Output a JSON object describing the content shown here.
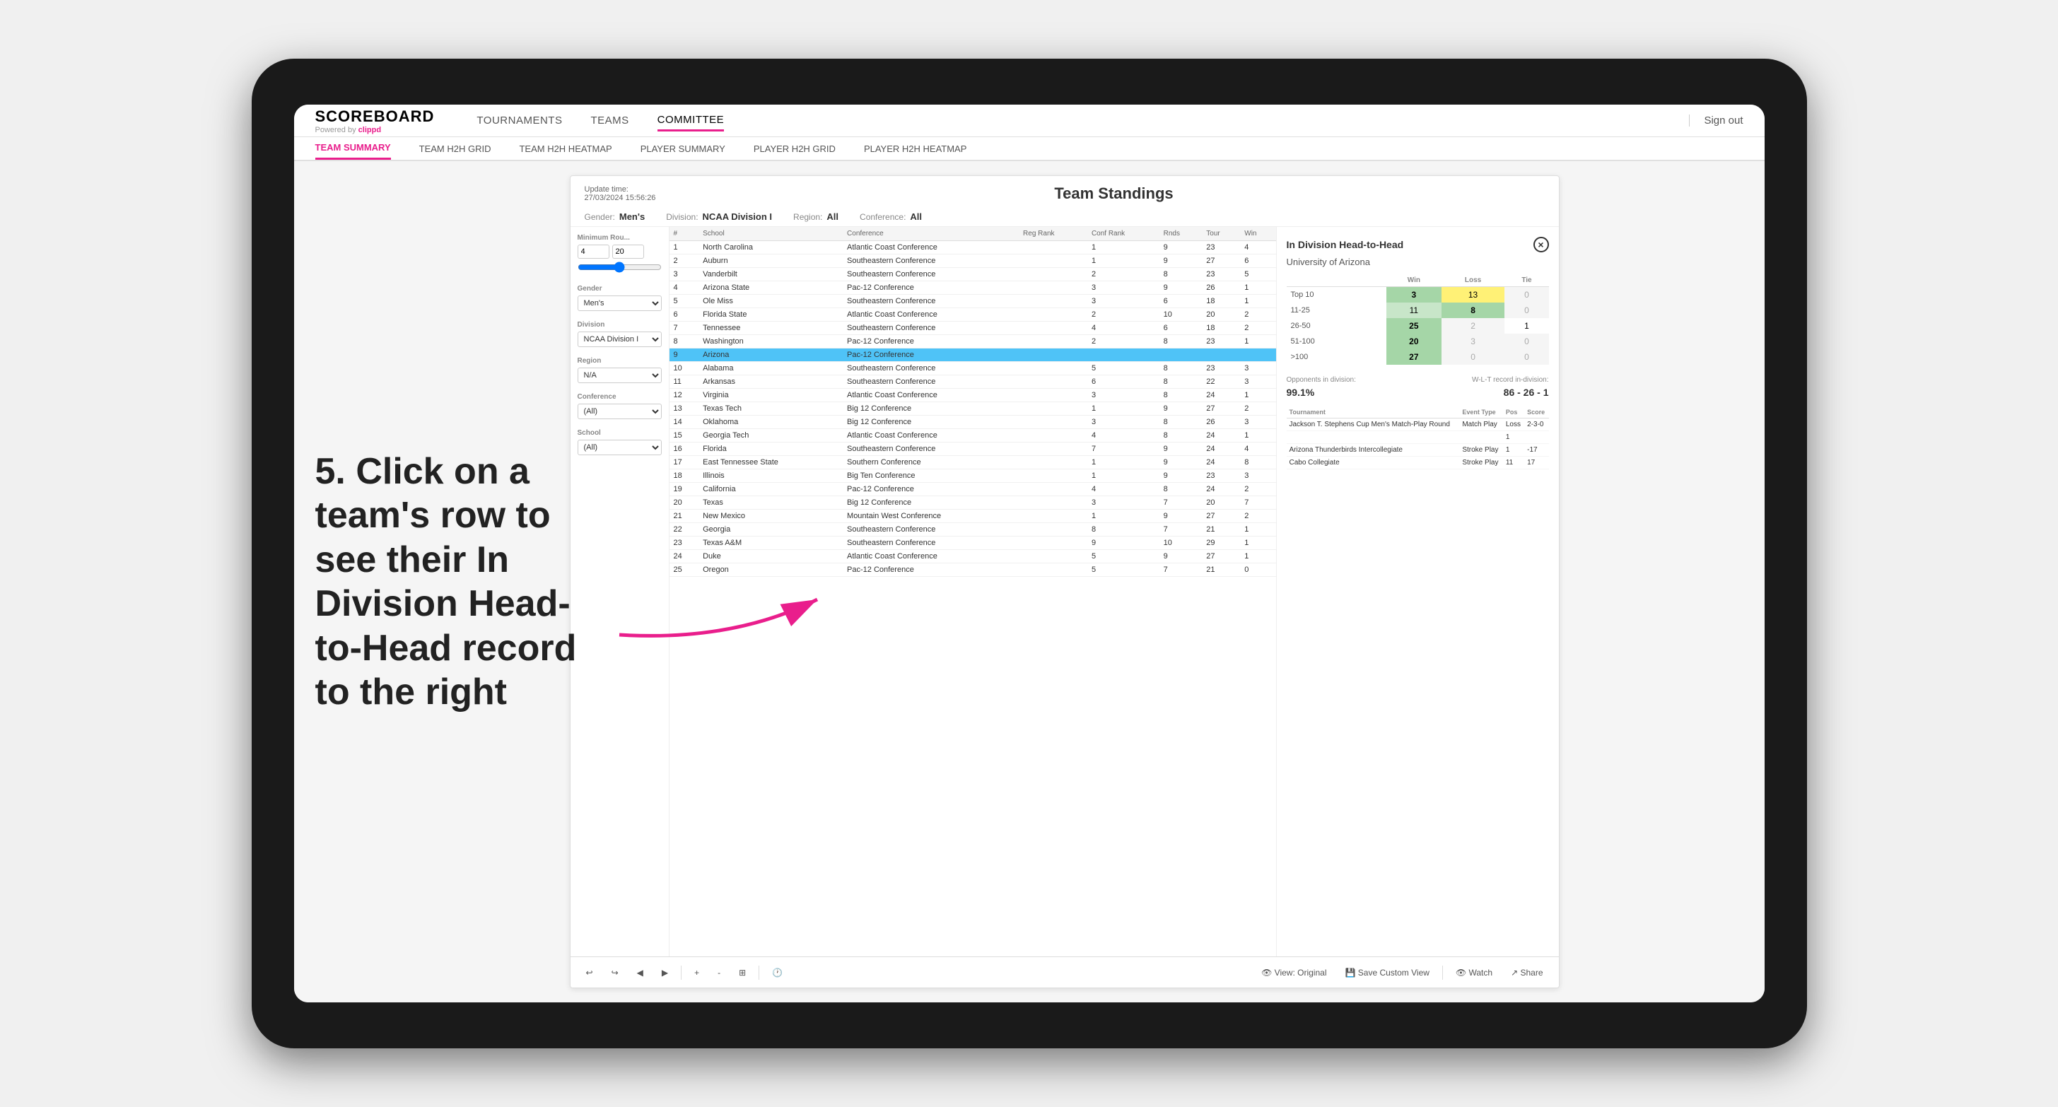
{
  "tablet": {
    "nav": {
      "logo": "SCOREBOARD",
      "powered_by": "Powered by clippd",
      "items": [
        "TOURNAMENTS",
        "TEAMS",
        "COMMITTEE"
      ],
      "active_item": "COMMITTEE",
      "sign_out": "Sign out"
    },
    "sub_nav": {
      "items": [
        "TEAM SUMMARY",
        "TEAM H2H GRID",
        "TEAM H2H HEATMAP",
        "PLAYER SUMMARY",
        "PLAYER H2H GRID",
        "PLAYER H2H HEATMAP"
      ],
      "active_item": "TEAM SUMMARY"
    }
  },
  "annotation": {
    "text": "5. Click on a team's row to see their In Division Head-to-Head record to the right"
  },
  "dashboard": {
    "update_time_label": "Update time:",
    "update_time": "27/03/2024 15:56:26",
    "title": "Team Standings",
    "filters": {
      "gender_label": "Gender:",
      "gender_value": "Men's",
      "division_label": "Division:",
      "division_value": "NCAA Division I",
      "region_label": "Region:",
      "region_value": "All",
      "conference_label": "Conference:",
      "conference_value": "All"
    },
    "sidebar": {
      "min_rounds_label": "Minimum Rou...",
      "min_rounds_from": "4",
      "min_rounds_to": "20",
      "gender_label": "Gender",
      "gender_value": "Men's",
      "division_label": "Division",
      "division_value": "NCAA Division I",
      "region_label": "Region",
      "region_value": "N/A",
      "conference_label": "Conference",
      "conference_value": "(All)",
      "school_label": "School",
      "school_value": "(All)"
    },
    "table": {
      "headers": [
        "#",
        "School",
        "Conference",
        "Reg Rank",
        "Conf Rank",
        "Rnds",
        "Tour",
        "Win"
      ],
      "rows": [
        {
          "rank": 1,
          "school": "North Carolina",
          "conference": "Atlantic Coast Conference",
          "reg_rank": "",
          "conf_rank": 1,
          "rnds": 9,
          "tour": 23,
          "win": 4
        },
        {
          "rank": 2,
          "school": "Auburn",
          "conference": "Southeastern Conference",
          "reg_rank": "",
          "conf_rank": 1,
          "rnds": 9,
          "tour": 27,
          "win": 6
        },
        {
          "rank": 3,
          "school": "Vanderbilt",
          "conference": "Southeastern Conference",
          "reg_rank": "",
          "conf_rank": 2,
          "rnds": 8,
          "tour": 23,
          "win": 5
        },
        {
          "rank": 4,
          "school": "Arizona State",
          "conference": "Pac-12 Conference",
          "reg_rank": "",
          "conf_rank": 3,
          "rnds": 9,
          "tour": 26,
          "win": 1
        },
        {
          "rank": 5,
          "school": "Ole Miss",
          "conference": "Southeastern Conference",
          "reg_rank": "",
          "conf_rank": 3,
          "rnds": 6,
          "tour": 18,
          "win": 1
        },
        {
          "rank": 6,
          "school": "Florida State",
          "conference": "Atlantic Coast Conference",
          "reg_rank": "",
          "conf_rank": 2,
          "rnds": 10,
          "tour": 20,
          "win": 2
        },
        {
          "rank": 7,
          "school": "Tennessee",
          "conference": "Southeastern Conference",
          "reg_rank": "",
          "conf_rank": 4,
          "rnds": 6,
          "tour": 18,
          "win": 2
        },
        {
          "rank": 8,
          "school": "Washington",
          "conference": "Pac-12 Conference",
          "reg_rank": "",
          "conf_rank": 2,
          "rnds": 8,
          "tour": 23,
          "win": 1
        },
        {
          "rank": 9,
          "school": "Arizona",
          "conference": "Pac-12 Conference",
          "reg_rank": "",
          "conf_rank": "",
          "rnds": "",
          "tour": "",
          "win": "",
          "selected": true
        },
        {
          "rank": 10,
          "school": "Alabama",
          "conference": "Southeastern Conference",
          "reg_rank": "",
          "conf_rank": 5,
          "rnds": 8,
          "tour": 23,
          "win": 3
        },
        {
          "rank": 11,
          "school": "Arkansas",
          "conference": "Southeastern Conference",
          "reg_rank": "",
          "conf_rank": 6,
          "rnds": 8,
          "tour": 22,
          "win": 3
        },
        {
          "rank": 12,
          "school": "Virginia",
          "conference": "Atlantic Coast Conference",
          "reg_rank": "",
          "conf_rank": 3,
          "rnds": 8,
          "tour": 24,
          "win": 1
        },
        {
          "rank": 13,
          "school": "Texas Tech",
          "conference": "Big 12 Conference",
          "reg_rank": "",
          "conf_rank": 1,
          "rnds": 9,
          "tour": 27,
          "win": 2
        },
        {
          "rank": 14,
          "school": "Oklahoma",
          "conference": "Big 12 Conference",
          "reg_rank": "",
          "conf_rank": 3,
          "rnds": 8,
          "tour": 26,
          "win": 3
        },
        {
          "rank": 15,
          "school": "Georgia Tech",
          "conference": "Atlantic Coast Conference",
          "reg_rank": "",
          "conf_rank": 4,
          "rnds": 8,
          "tour": 24,
          "win": 1
        },
        {
          "rank": 16,
          "school": "Florida",
          "conference": "Southeastern Conference",
          "reg_rank": "",
          "conf_rank": 7,
          "rnds": 9,
          "tour": 24,
          "win": 4
        },
        {
          "rank": 17,
          "school": "East Tennessee State",
          "conference": "Southern Conference",
          "reg_rank": "",
          "conf_rank": 1,
          "rnds": 9,
          "tour": 24,
          "win": 8
        },
        {
          "rank": 18,
          "school": "Illinois",
          "conference": "Big Ten Conference",
          "reg_rank": "",
          "conf_rank": 1,
          "rnds": 9,
          "tour": 23,
          "win": 3
        },
        {
          "rank": 19,
          "school": "California",
          "conference": "Pac-12 Conference",
          "reg_rank": "",
          "conf_rank": 4,
          "rnds": 8,
          "tour": 24,
          "win": 2
        },
        {
          "rank": 20,
          "school": "Texas",
          "conference": "Big 12 Conference",
          "reg_rank": "",
          "conf_rank": 3,
          "rnds": 7,
          "tour": 20,
          "win": 7
        },
        {
          "rank": 21,
          "school": "New Mexico",
          "conference": "Mountain West Conference",
          "reg_rank": "",
          "conf_rank": 1,
          "rnds": 9,
          "tour": 27,
          "win": 2
        },
        {
          "rank": 22,
          "school": "Georgia",
          "conference": "Southeastern Conference",
          "reg_rank": "",
          "conf_rank": 8,
          "rnds": 7,
          "tour": 21,
          "win": 1
        },
        {
          "rank": 23,
          "school": "Texas A&M",
          "conference": "Southeastern Conference",
          "reg_rank": "",
          "conf_rank": 9,
          "rnds": 10,
          "tour": 29,
          "win": 1
        },
        {
          "rank": 24,
          "school": "Duke",
          "conference": "Atlantic Coast Conference",
          "reg_rank": "",
          "conf_rank": 5,
          "rnds": 9,
          "tour": 27,
          "win": 1
        },
        {
          "rank": 25,
          "school": "Oregon",
          "conference": "Pac-12 Conference",
          "reg_rank": "",
          "conf_rank": 5,
          "rnds": 7,
          "tour": 21,
          "win": 0
        }
      ]
    },
    "h2h_panel": {
      "title": "In Division Head-to-Head",
      "team": "University of Arizona",
      "close_btn": "×",
      "table_headers": [
        "",
        "Win",
        "Loss",
        "Tie"
      ],
      "rows": [
        {
          "label": "Top 10",
          "win": 3,
          "loss": 13,
          "tie": 0,
          "win_color": "green",
          "loss_color": "yellow"
        },
        {
          "label": "11-25",
          "win": 11,
          "loss": 8,
          "tie": 0,
          "win_color": "light-green",
          "loss_color": "green"
        },
        {
          "label": "26-50",
          "win": 25,
          "loss": 2,
          "tie": 1,
          "win_color": "green",
          "loss_color": "zero"
        },
        {
          "label": "51-100",
          "win": 20,
          "loss": 3,
          "tie": 0,
          "win_color": "green",
          "loss_color": "zero"
        },
        {
          "label": ">100",
          "win": 27,
          "loss": 0,
          "tie": 0,
          "win_color": "green",
          "loss_color": "zero"
        }
      ],
      "opponents_label": "Opponents in division:",
      "opponents_pct": "99.1%",
      "wlt_label": "W-L-T record in-division:",
      "wlt_record": "86 - 26 - 1",
      "tournament_headers": [
        "Tournament",
        "Event Type",
        "Pos",
        "Score"
      ],
      "tournament_rows": [
        {
          "name": "Jackson T. Stephens Cup Men's Match-Play Round",
          "type": "Match Play",
          "pos": "Loss",
          "score": "2-3-0"
        },
        {
          "name": "",
          "type": "",
          "pos": "1",
          "score": ""
        },
        {
          "name": "Arizona Thunderbirds Intercollegiate",
          "type": "Stroke Play",
          "pos": "1",
          "score": "-17"
        },
        {
          "name": "Cabo Collegiate",
          "type": "Stroke Play",
          "pos": "11",
          "score": "17"
        }
      ]
    },
    "toolbar": {
      "undo": "↩",
      "redo": "↪",
      "back": "◀",
      "forward": "▶",
      "zoom_in": "+",
      "zoom_out": "-",
      "fit": "⊞",
      "clock": "🕐",
      "view_original": "View: Original",
      "save_custom": "💾 Save Custom View",
      "watch": "👁 Watch",
      "share": "↗ Share"
    }
  }
}
